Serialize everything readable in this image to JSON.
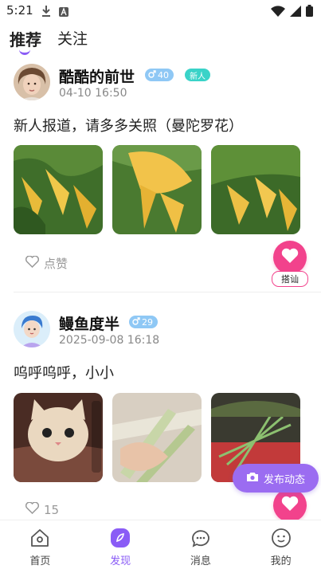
{
  "status_bar": {
    "time": "5:21"
  },
  "tabs": [
    {
      "label": "推荐",
      "active": true
    },
    {
      "label": "关注",
      "active": false
    }
  ],
  "posts": [
    {
      "username": "酷酷的前世",
      "gender_badge": "40",
      "new_badge": "新人",
      "timestamp": "04-10 16:50",
      "text": "新人报道，请多多关照（曼陀罗花）",
      "like_label": "点赞",
      "greet_label": "搭讪"
    },
    {
      "username": "鳗鱼度半",
      "gender_badge": "29",
      "timestamp": "2025-09-08 16:18",
      "text": "呜呼呜呼，小小",
      "like_count": "15"
    }
  ],
  "publish_button": {
    "label": "发布动态"
  },
  "bottom_nav": [
    {
      "label": "首页",
      "icon": "home-icon"
    },
    {
      "label": "发现",
      "icon": "discover-icon",
      "active": true
    },
    {
      "label": "消息",
      "icon": "message-icon"
    },
    {
      "label": "我的",
      "icon": "profile-icon"
    }
  ],
  "colors": {
    "accent": "#8a5cf6",
    "heart": "#f2428c",
    "gender": "#8fc8f5",
    "new_badge": "#3ad3c8"
  }
}
